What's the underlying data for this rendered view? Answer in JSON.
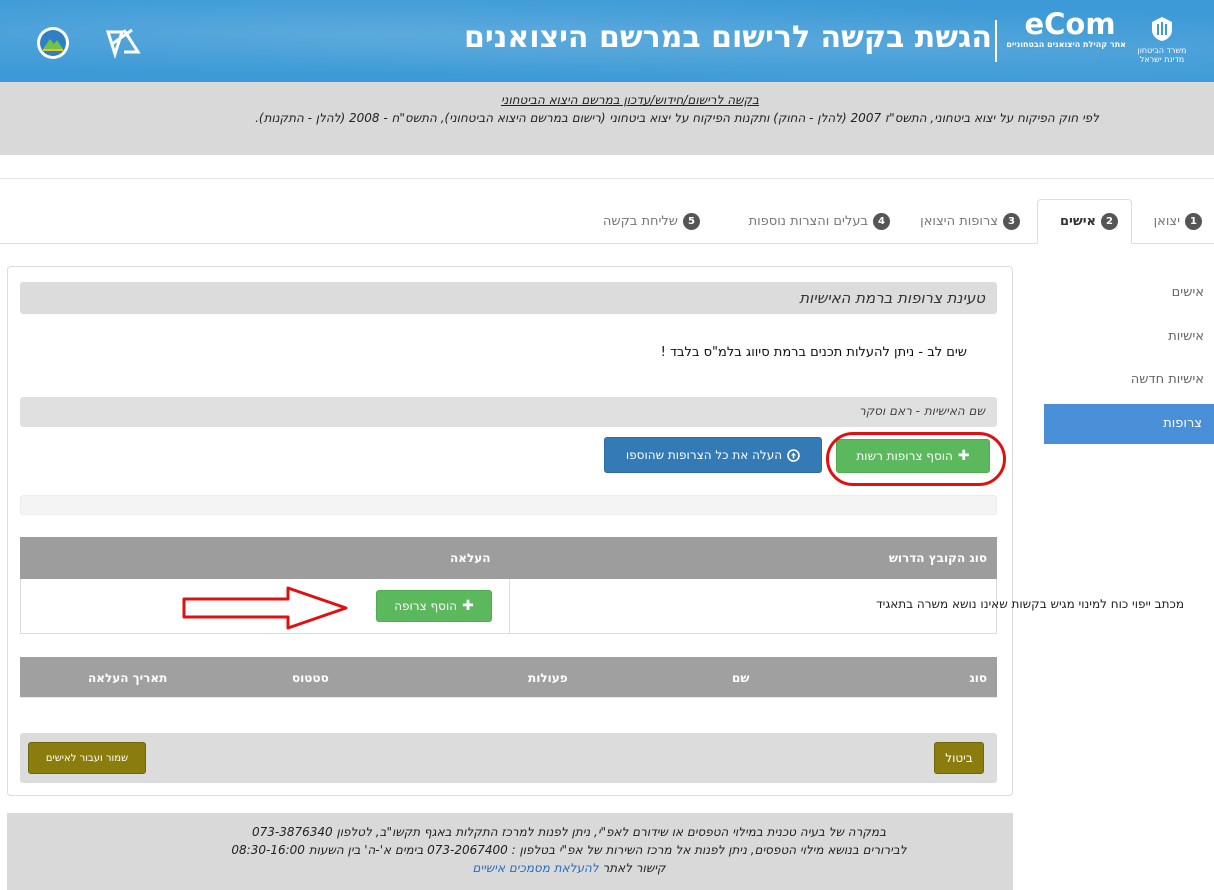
{
  "header": {
    "title": "הגשת בקשה לרישום במרשם היצואנים",
    "ecom_name": "eCom",
    "ecom_subtitle": "אתר קהילת היצואנים הבטחוניים",
    "ministry_line1": "משרד הביטחון",
    "ministry_line2": "מדינת ישראל",
    "bg_color": "#3d9ad6"
  },
  "subheader": {
    "link_text": "בקשה לרישום/חידוש/עדכון במרשם היצוא הביטחוני",
    "law_text": "לפי חוק הפיקוח על יצוא ביטחוני, התשס\"ז 2007 (להלן - החוק) ותקנות הפיקוח על יצוא ביטחוני (רישום במרשם היצוא הביטחוני), התשס\"ח - 2008 (להלן - התקנות)."
  },
  "tabs": [
    {
      "num": "1",
      "label": "יצואן"
    },
    {
      "num": "2",
      "label": "אישים"
    },
    {
      "num": "3",
      "label": "צרופות היצואן"
    },
    {
      "num": "4",
      "label": "בעלים והצרות נוספות"
    },
    {
      "num": "5",
      "label": "שליחת בקשה"
    }
  ],
  "sidebar": {
    "items": [
      "אישים",
      "אישיות",
      "אישיות חדשה",
      "צרופות"
    ]
  },
  "main": {
    "section_title": "טעינת צרופות ברמת האישיות",
    "notice": "שים לב - ניתן להעלות תכנים ברמת סיווג בלמ\"ס בלבד !",
    "personality_label": "שם האישיות - ראם וסקר",
    "add_optional_label": "הוסף צרופות רשות",
    "upload_all_label": "העלה את כל הצרופות שהוספו"
  },
  "attachments_table": {
    "headers": {
      "type": "סוג הקובץ הדרוש",
      "upload": "העלאה"
    },
    "rows": [
      {
        "type": "מכתב ייפוי כוח למינוי מגיש בקשות שאינו נושא משרה בתאגיד",
        "button": "הוסף צרופה"
      }
    ]
  },
  "files_table": {
    "headers": [
      "סוג",
      "שם",
      "פעולות",
      "סטטוס",
      "תאריך העלאה"
    ]
  },
  "actions": {
    "cancel_label": "ביטול",
    "save_label": "שמור ועבור לאישים"
  },
  "footer": {
    "line1": "במקרה של בעיה טכנית במילוי הטפסים או שידורם לאפ\"י, ניתן לפנות למרכז התקלות באגף תקשו\"ב, לטלפון 073-3876340",
    "line2": "לבירורים בנושא מילוי הטפסים, ניתן לפנות אל מרכז השירות של אפ\"י בטלפון : 073-2067400 בימים א'-ה' בין השעות 08:30-16:00",
    "line3_prefix": "קישור לאתר",
    "line3_link": "להעלאת מסמכים אישיים"
  },
  "colors": {
    "accent_blue": "#337ab7",
    "green": "#5cb85c",
    "olive": "#8a7d0e",
    "annotation_red": "#e01010"
  }
}
